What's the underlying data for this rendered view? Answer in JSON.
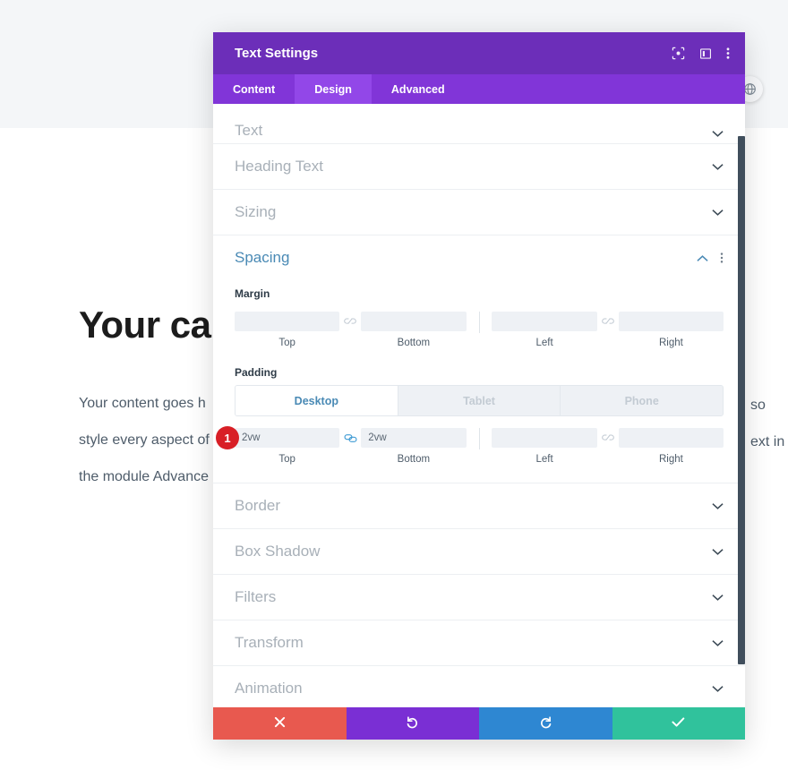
{
  "background": {
    "heading": "Your call t",
    "paragraph_lines": [
      "Your content goes h",
      "style every aspect of",
      "the module Advance"
    ],
    "right_fragments": [
      "so",
      "ext in"
    ],
    "globe_icon": "globe-icon"
  },
  "modal": {
    "title": "Text Settings",
    "header_icons": [
      {
        "name": "focus-icon",
        "label": "Focus"
      },
      {
        "name": "layout-panel-icon",
        "label": "Layout"
      },
      {
        "name": "kebab-menu-icon",
        "label": "More options"
      }
    ],
    "tabs": [
      {
        "label": "Content",
        "active": false
      },
      {
        "label": "Design",
        "active": true
      },
      {
        "label": "Advanced",
        "active": false
      }
    ],
    "sections_above": [
      {
        "label": "Text",
        "state": "collapsed"
      },
      {
        "label": "Heading Text",
        "state": "collapsed"
      },
      {
        "label": "Sizing",
        "state": "collapsed"
      }
    ],
    "spacing": {
      "title": "Spacing",
      "collapse_icon": "chevron-up-icon",
      "kebab_icon": "kebab-menu-icon",
      "margin": {
        "label": "Margin",
        "link_state_vertical": "unlinked",
        "link_state_horizontal": "unlinked",
        "fields": [
          {
            "caption": "Top",
            "value": ""
          },
          {
            "caption": "Bottom",
            "value": ""
          },
          {
            "caption": "Left",
            "value": ""
          },
          {
            "caption": "Right",
            "value": ""
          }
        ]
      },
      "padding": {
        "label": "Padding",
        "devices": [
          {
            "label": "Desktop",
            "active": true
          },
          {
            "label": "Tablet",
            "active": false
          },
          {
            "label": "Phone",
            "active": false
          }
        ],
        "link_state_vertical": "linked",
        "link_state_horizontal": "unlinked",
        "badge": "1",
        "fields": [
          {
            "caption": "Top",
            "value": "2vw"
          },
          {
            "caption": "Bottom",
            "value": "2vw"
          },
          {
            "caption": "Left",
            "value": ""
          },
          {
            "caption": "Right",
            "value": ""
          }
        ]
      }
    },
    "sections_below": [
      {
        "label": "Border",
        "state": "collapsed"
      },
      {
        "label": "Box Shadow",
        "state": "collapsed"
      },
      {
        "label": "Filters",
        "state": "collapsed"
      },
      {
        "label": "Transform",
        "state": "collapsed"
      },
      {
        "label": "Animation",
        "state": "collapsed"
      }
    ],
    "footer": [
      {
        "name": "cancel-button",
        "icon": "close-icon",
        "color": "#e8594f"
      },
      {
        "name": "undo-button",
        "icon": "undo-icon",
        "color": "#7a2fd4"
      },
      {
        "name": "redo-button",
        "icon": "redo-icon",
        "color": "#2e87d2"
      },
      {
        "name": "save-button",
        "icon": "check-icon",
        "color": "#30c29c"
      }
    ]
  },
  "colors": {
    "header_purple": "#6c2eb9",
    "tabs_purple": "#8135d8",
    "tab_active_purple": "#9247e8",
    "accent_blue": "#4a8ab5",
    "badge_red": "#d81f26"
  }
}
